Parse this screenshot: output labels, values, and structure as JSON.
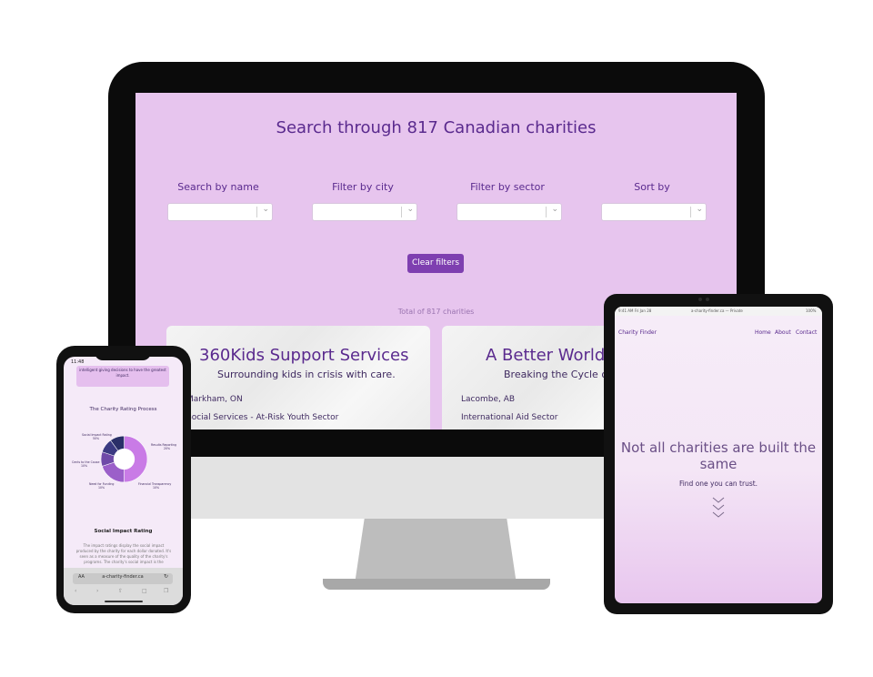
{
  "desktop": {
    "title": "Search through 817 Canadian charities",
    "filters": [
      {
        "label": "Search by name"
      },
      {
        "label": "Filter by city"
      },
      {
        "label": "Filter by sector"
      },
      {
        "label": "Sort by"
      }
    ],
    "clear_button": "Clear filters",
    "total": "Total of 817 charities",
    "cards": [
      {
        "name": "360Kids Support Services",
        "tagline": "Surrounding kids in crisis with care.",
        "city": "Markham, ON",
        "sector": "Social Services - At-Risk Youth Sector"
      },
      {
        "name": "A Better World",
        "tagline": "Breaking the Cycle of",
        "city": "Lacombe, AB",
        "sector": "International Aid Sector"
      }
    ]
  },
  "phone": {
    "time": "11:48",
    "intro": "intelligent giving decisions to have the greatest impact.",
    "section_title": "The Charity Rating Process",
    "chart_labels": {
      "social_impact": "Social Impact Rating",
      "social_impact_pct": "50%",
      "results_reporting": "Results Reporting",
      "results_reporting_pct": "20%",
      "cents_to_cause": "Cents to the Cause",
      "cents_to_cause_pct": "10%",
      "need_for_funding": "Need for Funding",
      "need_for_funding_pct": "10%",
      "financial_transparency": "Financial Transparency",
      "financial_transparency_pct": "10%"
    },
    "social_title": "Social Impact Rating",
    "social_text": "The impact ratings display the social impact produced by the charity for each dollar donated. It's seen as a measure of the quality of the charity's programs. The charity's social impact is the",
    "url_aa": "AA",
    "url": "a-charity-finder.ca"
  },
  "tablet": {
    "status_time": "9:41 AM  Fri Jan 28",
    "status_url": "a-charity-finder.ca — Private",
    "status_battery": "100%",
    "brand": "Charity Finder",
    "nav": [
      "Home",
      "About",
      "Contact"
    ],
    "hero": "Not all charities are built the same",
    "subtitle": "Find one you can trust."
  },
  "chart_data": {
    "type": "pie",
    "title": "The Charity Rating Process",
    "categories": [
      "Social Impact Rating",
      "Results Reporting",
      "Cents to the Cause",
      "Need for Funding",
      "Financial Transparency"
    ],
    "values": [
      50,
      20,
      10,
      10,
      10
    ],
    "colors": [
      "#c97be6",
      "#9b5fc9",
      "#6f4aa8",
      "#3b3a82",
      "#2a2f68"
    ]
  },
  "colors": {
    "screen_bg": "#e7c5ee",
    "accent": "#7e3fb0",
    "title_text": "#5a2a8e"
  }
}
